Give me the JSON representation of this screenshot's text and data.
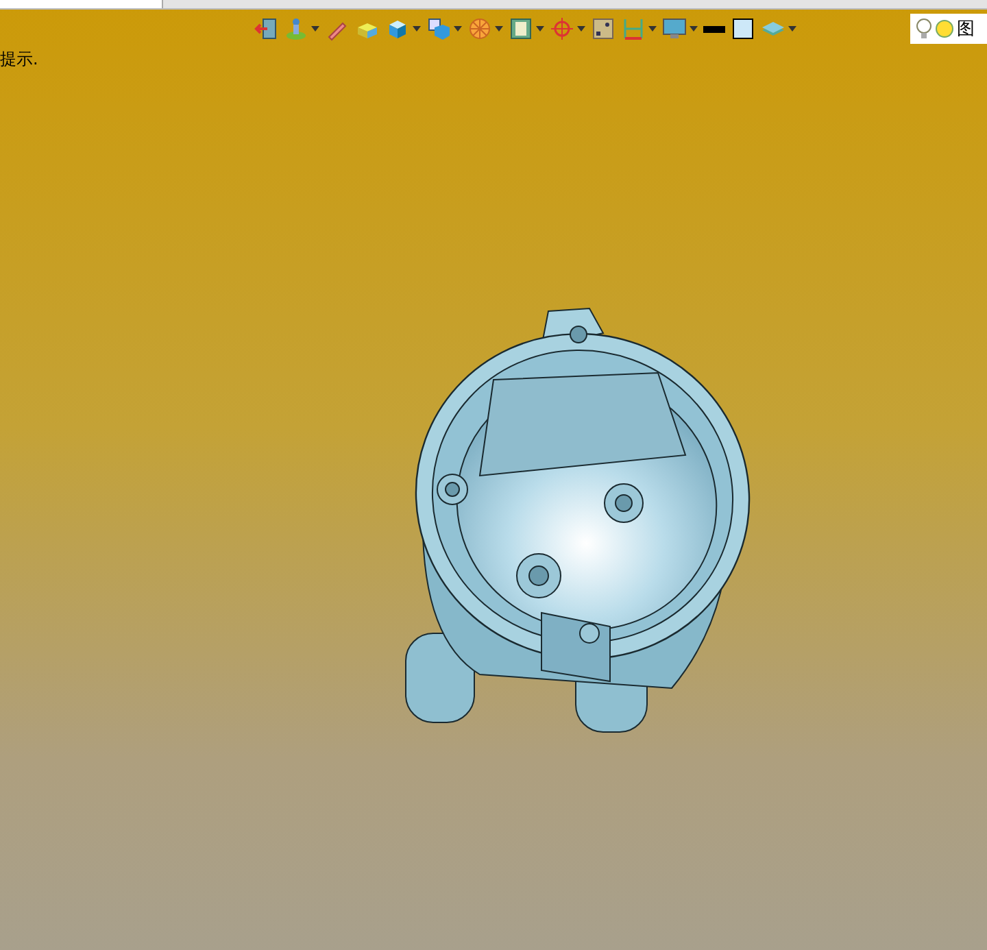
{
  "toolbar": {
    "tools": [
      {
        "kind": "exit",
        "dropdown": false
      },
      {
        "kind": "figure",
        "dropdown": true
      },
      {
        "kind": "pencil",
        "dropdown": false
      },
      {
        "kind": "slab",
        "dropdown": false
      },
      {
        "kind": "cube",
        "dropdown": true
      },
      {
        "kind": "view",
        "dropdown": true
      },
      {
        "kind": "wheel",
        "dropdown": true
      },
      {
        "kind": "frame",
        "dropdown": true
      },
      {
        "kind": "crosshair",
        "dropdown": true
      },
      {
        "kind": "picture",
        "dropdown": false
      },
      {
        "kind": "bracket",
        "dropdown": true
      },
      {
        "kind": "monitor",
        "dropdown": true
      },
      {
        "kind": "bar",
        "dropdown": false
      },
      {
        "kind": "square",
        "dropdown": false
      },
      {
        "kind": "layers",
        "dropdown": true
      }
    ],
    "layer_box": {
      "label": "图"
    }
  },
  "hint": "提示."
}
